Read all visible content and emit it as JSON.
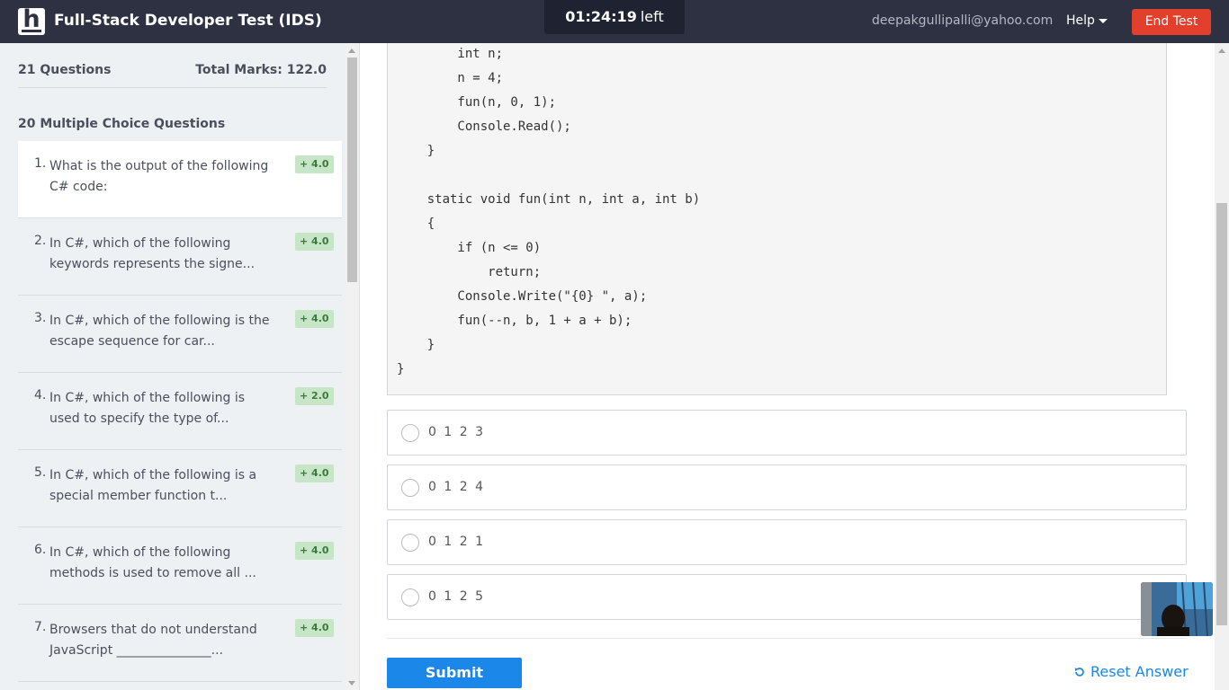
{
  "app": {
    "logo_letter": "h",
    "title": "Full-Stack Developer Test (IDS)"
  },
  "timer": {
    "time": "01:24:19",
    "suffix": "left"
  },
  "header": {
    "email": "deepakgullipalli@yahoo.com",
    "help_label": "Help",
    "end_test_label": "End Test"
  },
  "sidebar": {
    "questions_count": "21 Questions",
    "total_marks": "Total Marks: 122.0",
    "section_title": "20 Multiple Choice Questions",
    "questions": [
      {
        "num": "1.",
        "text": "What is the output of the following C# code:",
        "marks": "+ 4.0",
        "active": true
      },
      {
        "num": "2.",
        "text": "In C#, which of the following keywords represents the signe...",
        "marks": "+ 4.0"
      },
      {
        "num": "3.",
        "text": "In C#, which of the following is the escape sequence for car...",
        "marks": "+ 4.0"
      },
      {
        "num": "4.",
        "text": "In C#, which of the following is used to specify the type of...",
        "marks": "+ 2.0"
      },
      {
        "num": "5.",
        "text": "In C#, which of the following is a special member function t...",
        "marks": "+ 4.0"
      },
      {
        "num": "6.",
        "text": "In C#, which of the following methods is used to remove all ...",
        "marks": "+ 4.0"
      },
      {
        "num": "7.",
        "text": "Browsers that do not understand JavaScript _______________...",
        "marks": "+ 4.0"
      }
    ]
  },
  "code": [
    "        int n;",
    "        n = 4;",
    "        fun(n, 0, 1);",
    "        Console.Read();",
    "    }",
    "",
    "    static void fun(int n, int a, int b)",
    "    {",
    "        if (n <= 0)",
    "            return;",
    "        Console.Write(\"{0} \", a);",
    "        fun(--n, b, 1 + a + b);",
    "    }",
    "}"
  ],
  "options": [
    {
      "label": "0 1 2 3"
    },
    {
      "label": "0 1 2 4"
    },
    {
      "label": "0 1 2 1"
    },
    {
      "label": "0 1 2 5"
    }
  ],
  "actions": {
    "submit_label": "Submit",
    "reset_label": "Reset Answer"
  },
  "colors": {
    "header_bg": "#2d3142",
    "end_test": "#e2402c",
    "primary": "#1b87e8",
    "marks_badge": "#c7e5c7"
  },
  "icons": {
    "reset": "undo-icon",
    "help_caret": "caret-down-icon"
  }
}
